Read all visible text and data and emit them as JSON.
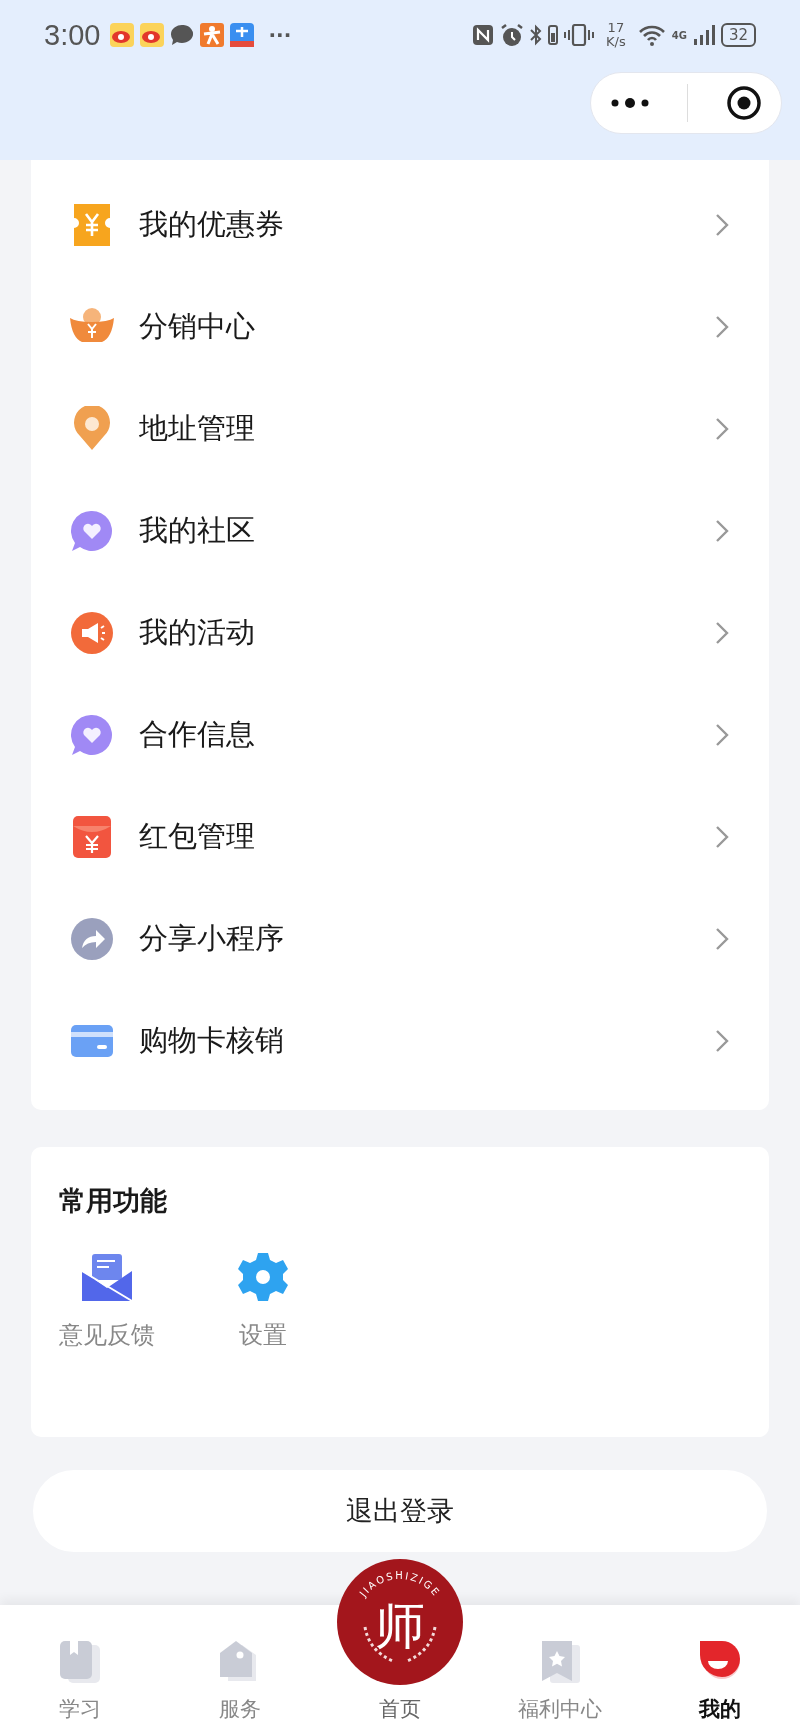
{
  "status_bar": {
    "time": "3:00",
    "more": "···",
    "speed_value": "17",
    "speed_unit": "K/s",
    "network": "4G",
    "battery": "32"
  },
  "menu": [
    {
      "kind": "coupon",
      "label": "我的优惠券"
    },
    {
      "kind": "ingot",
      "label": "分销中心"
    },
    {
      "kind": "pin",
      "label": "地址管理"
    },
    {
      "kind": "chat",
      "label": "我的社区"
    },
    {
      "kind": "megaphone",
      "label": "我的活动"
    },
    {
      "kind": "chat",
      "label": "合作信息"
    },
    {
      "kind": "packet",
      "label": "红包管理"
    },
    {
      "kind": "share",
      "label": "分享小程序"
    },
    {
      "kind": "card",
      "label": "购物卡核销"
    }
  ],
  "common": {
    "title": "常用功能",
    "items": [
      {
        "kind": "mail",
        "label": "意见反馈"
      },
      {
        "kind": "gear",
        "label": "设置"
      }
    ]
  },
  "logout": "退出登录",
  "logo": {
    "char": "师",
    "ring": "JIAOSHIZIGE"
  },
  "tabs": [
    {
      "kind": "book",
      "label": "学习",
      "selected": false
    },
    {
      "kind": "tag",
      "label": "服务",
      "selected": false
    },
    {
      "kind": "logo",
      "label": "首页",
      "selected": false
    },
    {
      "kind": "bookmark",
      "label": "福利中心",
      "selected": false
    },
    {
      "kind": "face",
      "label": "我的",
      "selected": true
    }
  ]
}
